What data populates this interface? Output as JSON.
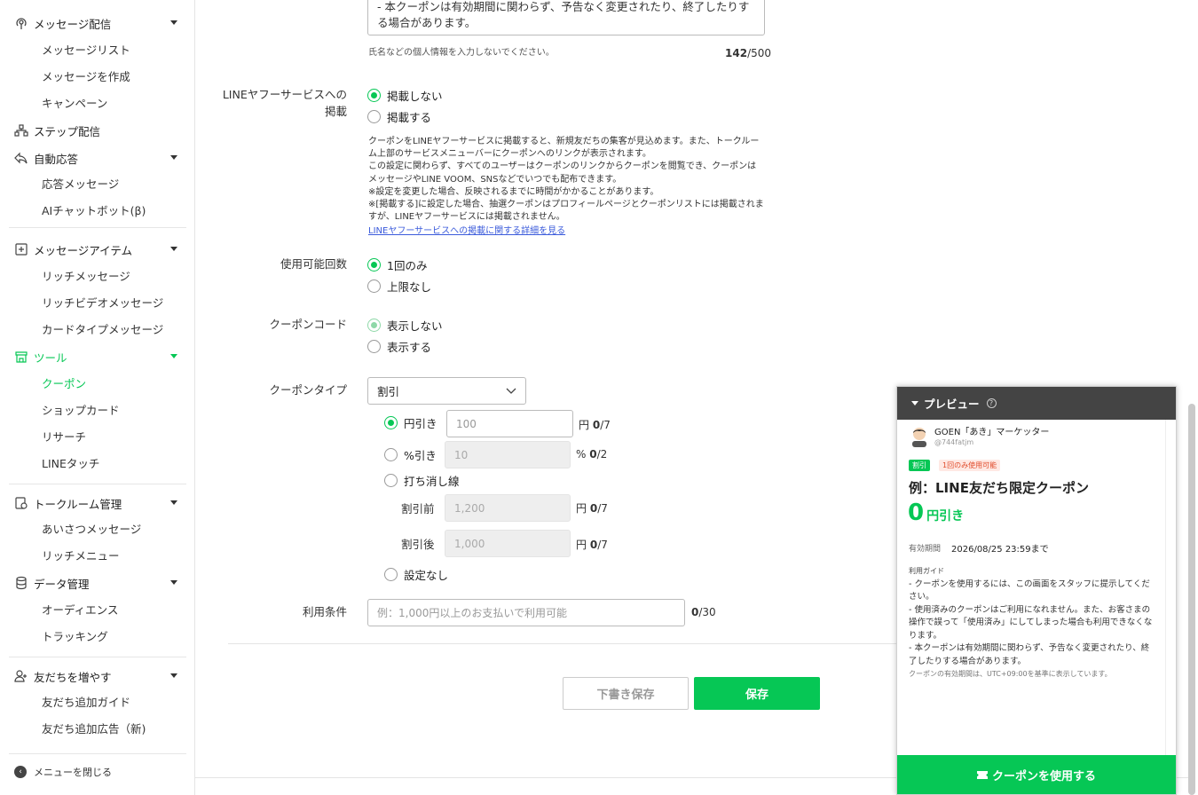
{
  "sidebar": {
    "groups": [
      {
        "label": "メッセージ配信",
        "items": [
          "メッセージリスト",
          "メッセージを作成",
          "キャンペーン"
        ]
      },
      {
        "label": "ステップ配信"
      },
      {
        "label": "自動応答",
        "items": [
          "応答メッセージ",
          "AIチャットボット(β)"
        ]
      },
      {
        "label": "メッセージアイテム",
        "items": [
          "リッチメッセージ",
          "リッチビデオメッセージ",
          "カードタイプメッセージ"
        ]
      },
      {
        "label": "ツール",
        "items": [
          "クーポン",
          "ショップカード",
          "リサーチ",
          "LINEタッチ"
        ]
      },
      {
        "label": "トークルーム管理",
        "items": [
          "あいさつメッセージ",
          "リッチメニュー"
        ]
      },
      {
        "label": "データ管理",
        "items": [
          "オーディエンス",
          "トラッキング"
        ]
      },
      {
        "label": "友だちを増やす",
        "items": [
          "友だち追加ガイド",
          "友だち追加広告（新)"
        ]
      }
    ],
    "close_label": "メニューを閉じる"
  },
  "form": {
    "notes_text": "- 本クーポンは有効期間に関わらず、予告なく変更されたり、終了したりする場合があります。",
    "notes_hint": "氏名などの個人情報を入力しないでください。",
    "notes_count": "142",
    "notes_max": "/500",
    "listing": {
      "label": "LINEヤフーサービスへの掲載",
      "options": [
        "掲載しない",
        "掲載する"
      ],
      "desc": [
        "クーポンをLINEヤフーサービスに掲載すると、新規友だちの集客が見込めます。また、トークルーム上部のサービスメニューバーにクーポンへのリンクが表示されます。",
        "この設定に関わらず、すべてのユーザーはクーポンのリンクからクーポンを閲覧でき、クーポンはメッセージやLINE VOOM、SNSなどでいつでも配布できます。",
        "※設定を変更した場合、反映されるまでに時間がかかることがあります。",
        "※[掲載する]に設定した場合、抽選クーポンはプロフィールページとクーポンリストには掲載されますが、LINEヤフーサービスには掲載されません。"
      ],
      "link": "LINEヤフーサービスへの掲載に関する詳細を見る"
    },
    "usage": {
      "label": "使用可能回数",
      "options": [
        "1回のみ",
        "上限なし"
      ]
    },
    "code": {
      "label": "クーポンコード",
      "options": [
        "表示しない",
        "表示する"
      ]
    },
    "type": {
      "label": "クーポンタイプ",
      "selected": "割引",
      "yen": {
        "label": "円引き",
        "placeholder": "100",
        "unit": "円",
        "count": "0",
        "max": "/7"
      },
      "pct": {
        "label": "%引き",
        "placeholder": "10",
        "unit": "%",
        "count": "0",
        "max": "/2"
      },
      "strike": {
        "label": "打ち消し線"
      },
      "before": {
        "label": "割引前",
        "placeholder": "1,200",
        "unit": "円",
        "count": "0",
        "max": "/7"
      },
      "after": {
        "label": "割引後",
        "placeholder": "1,000",
        "unit": "円",
        "count": "0",
        "max": "/7"
      },
      "none": {
        "label": "設定なし"
      }
    },
    "conditions": {
      "label": "利用条件",
      "placeholder": "例：1,000円以上のお支払いで利用可能",
      "count": "0",
      "max": "/30"
    },
    "draft_button": "下書き保存",
    "save_button": "保存"
  },
  "preview": {
    "title": "プレビュー",
    "account_name": "GOEN「あき」マーケッター",
    "account_id": "@744fatjm",
    "badge_type": "割引",
    "badge_usage": "1回のみ使用可能",
    "coupon_title": "例：LINE友だち限定クーポン",
    "amount": "0",
    "amount_suffix": "円引き",
    "period_label": "有効期間",
    "period_value": "2026/08/25 23:59まで",
    "guide_label": "利用ガイド",
    "guide_lines": [
      "- クーポンを使用するには、この画面をスタッフに提示してください。",
      "- 使用済みのクーポンはご利用になれません。また、お客さまの操作で誤って「使用済み」にしてしまった場合も利用できなくなります。",
      "- 本クーポンは有効期間に関わらず、予告なく変更されたり、終了したりする場合があります。"
    ],
    "tz_note": "クーポンの有効期間は、UTC+09:00を基準に表示しています。",
    "use_button": "クーポンを使用する"
  },
  "colors": {
    "accent": "#06c755",
    "preview_header": "#444444",
    "badge_red": "#ffe9e4"
  }
}
